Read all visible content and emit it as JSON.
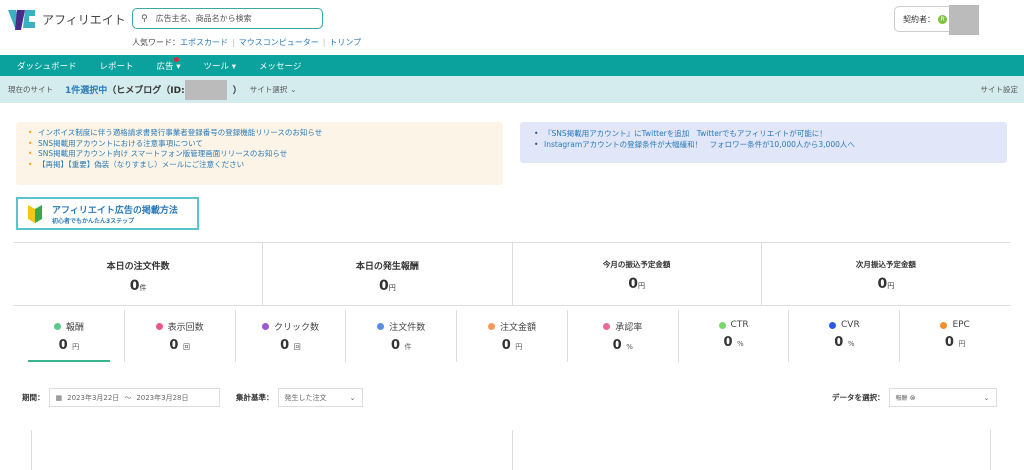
{
  "header": {
    "brand": "アフィリエイト",
    "search_placeholder": "広告主名、商品名から検索",
    "popular_label": "人気ワード：",
    "popular_words": [
      "エポスカード",
      "マウスコンピューター",
      "トリンプ"
    ],
    "contract_label": "契約者：",
    "contract_badge": "R"
  },
  "nav": {
    "items": [
      "ダッシュボード",
      "レポート",
      "広告",
      "ツール",
      "メッセージ"
    ]
  },
  "site_bar": {
    "label": "現在のサイト",
    "selected": "1件選択中",
    "site_name": "（ヒメブログ（ID:",
    "close": "）",
    "select": "サイト選択",
    "settings": "サイト設定"
  },
  "notices": [
    "インボイス制度に伴う適格請求書発行事業者登録番号の登録機能リリースのお知らせ",
    "SNS掲載用アカウントにおける注意事項について",
    "SNS掲載用アカウント向け スマートフォン版管理画面リリースのお知らせ",
    "【再掲】【重要】偽装（なりすまし）メールにご注意ください"
  ],
  "news": [
    "『SNS掲載用アカウント』にTwitterを追加　Twitterでもアフィリエイトが可能に！",
    "Instagramアカウントの登録条件が大幅緩和！　フォロワー条件が10,000人から3,000人へ"
  ],
  "guide": {
    "title": "アフィリエイト広告の掲載方法",
    "subtitle": "初心者でもかんたん3ステップ"
  },
  "stats": [
    {
      "label": "本日の注文件数",
      "value": "0",
      "unit": "件"
    },
    {
      "label": "本日の発生報酬",
      "value": "0",
      "unit": "円"
    },
    {
      "label": "今月の振込予定金額",
      "value": "0",
      "unit": "円"
    },
    {
      "label": "次月振込予定金額",
      "value": "0",
      "unit": "円"
    }
  ],
  "metrics": [
    {
      "label": "報酬",
      "value": "0",
      "unit": "円",
      "color": "#5cc98a"
    },
    {
      "label": "表示回数",
      "value": "0",
      "unit": "回",
      "color": "#e8578a"
    },
    {
      "label": "クリック数",
      "value": "0",
      "unit": "回",
      "color": "#9a5bd0"
    },
    {
      "label": "注文件数",
      "value": "0",
      "unit": "件",
      "color": "#5b8de0"
    },
    {
      "label": "注文金額",
      "value": "0",
      "unit": "円",
      "color": "#f39a5a"
    },
    {
      "label": "承認率",
      "value": "0",
      "unit": "%",
      "color": "#e86a9a"
    },
    {
      "label": "CTR",
      "value": "0",
      "unit": "%",
      "color": "#7ad66a"
    },
    {
      "label": "CVR",
      "value": "0",
      "unit": "%",
      "color": "#2a5ae0"
    },
    {
      "label": "EPC",
      "value": "0",
      "unit": "円",
      "color": "#f0902a"
    }
  ],
  "filter": {
    "period_label": "期間：",
    "date_from": "2023年3月22日",
    "tilde": "〜",
    "date_to": "2023年3月28日",
    "basis_label": "集計基準：",
    "basis_value": "発生した注文",
    "data_label": "データを選択：",
    "data_tag": "報酬"
  }
}
